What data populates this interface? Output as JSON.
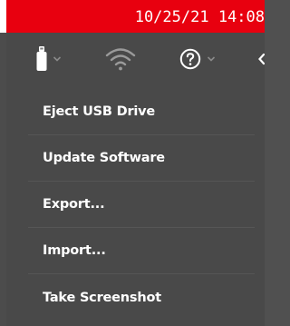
{
  "status_bar": {
    "datetime": "10/25/21 14:08",
    "background": "#e8000f"
  },
  "toolbar": {
    "icons": [
      "usb-drive-icon",
      "wifi-icon",
      "help-icon",
      "arrow-icon"
    ]
  },
  "menu": {
    "items": [
      {
        "label": "Eject USB Drive"
      },
      {
        "label": "Update Software"
      },
      {
        "label": "Export..."
      },
      {
        "label": "Import..."
      },
      {
        "label": "Take Screenshot"
      }
    ]
  }
}
